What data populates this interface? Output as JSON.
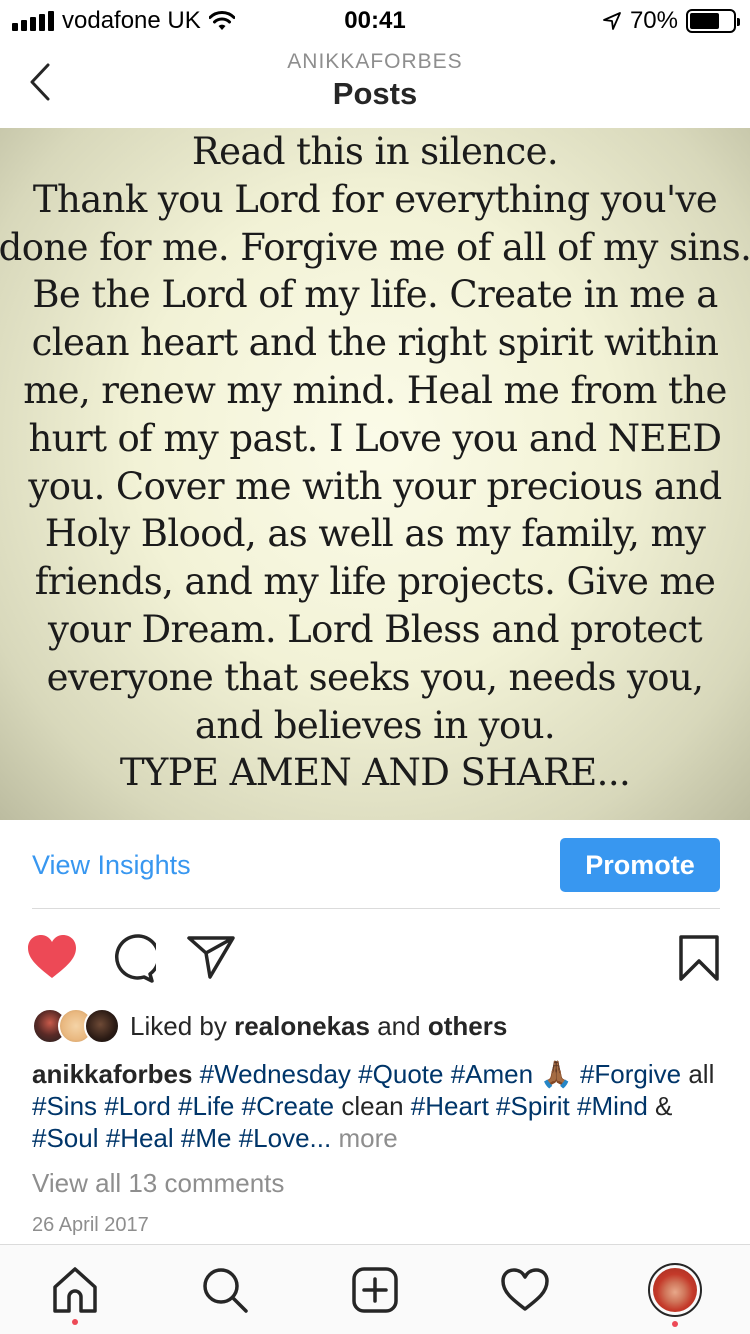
{
  "status_bar": {
    "carrier": "vodafone UK",
    "time": "00:41",
    "battery": "70%",
    "battery_level": 0.7
  },
  "nav": {
    "username": "ANIKKAFORBES",
    "title": "Posts"
  },
  "post": {
    "image_text_lines": [
      "Read this in silence.",
      "Thank you Lord for everything you've",
      "done for me. Forgive me of all of my sins.",
      "Be the Lord of my life. Create in me a",
      "clean heart and the right spirit within",
      "me, renew my mind. Heal me from the",
      "hurt of my past. I Love you and NEED",
      "you. Cover me with your precious and",
      "Holy Blood, as well as my family, my",
      "friends, and my life projects. Give me",
      "your Dream. Lord Bless and protect",
      "everyone that seeks you, needs you,",
      "and believes in you.",
      "TYPE AMEN AND SHARE..."
    ],
    "view_insights": "View Insights",
    "promote": "Promote",
    "liked_by_prefix": "Liked by",
    "liked_by_user": "realonekas",
    "liked_by_and": "and",
    "liked_by_others": "others",
    "caption_user": "anikkaforbes",
    "caption_parts": [
      {
        "t": "#Wednesday",
        "tag": true
      },
      {
        "t": "#Quote",
        "tag": true
      },
      {
        "t": "#Amen",
        "tag": true
      },
      {
        "t": "🙏🏾",
        "tag": false
      },
      {
        "t": "#Forgive",
        "tag": true
      },
      {
        "t": "all",
        "tag": false
      },
      {
        "t": "#Sins",
        "tag": true
      },
      {
        "t": "#Lord",
        "tag": true
      },
      {
        "t": "#Life",
        "tag": true
      },
      {
        "t": "#Create",
        "tag": true
      },
      {
        "t": "clean",
        "tag": false
      },
      {
        "t": "#Heart",
        "tag": true
      },
      {
        "t": "#Spirit",
        "tag": true
      },
      {
        "t": "#Mind",
        "tag": true
      },
      {
        "t": "&",
        "tag": false
      },
      {
        "t": "#Soul",
        "tag": true
      },
      {
        "t": "#Heal",
        "tag": true
      },
      {
        "t": "#Me",
        "tag": true
      },
      {
        "t": "#Love...",
        "tag": true
      }
    ],
    "caption_more": "more",
    "view_comments": "View all 13 comments",
    "date": "26 April 2017"
  },
  "icons": {
    "like": "heart-filled-icon",
    "comment": "comment-icon",
    "share": "paper-plane-icon",
    "save": "bookmark-icon",
    "tabs": [
      "home-icon",
      "search-icon",
      "add-post-icon",
      "activity-heart-icon",
      "profile-avatar"
    ]
  },
  "colors": {
    "accent": "#3897f0",
    "like_red": "#ed4956",
    "hashtag": "#003569",
    "muted": "#8e8e8e"
  }
}
